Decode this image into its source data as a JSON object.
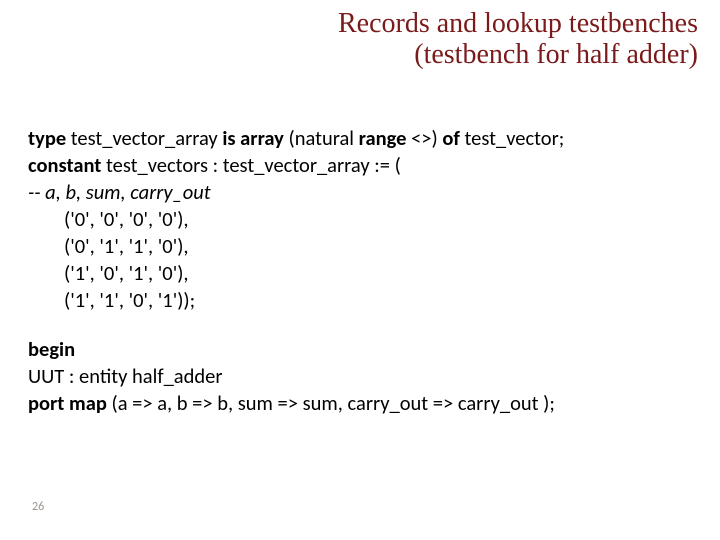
{
  "title_line1": "Records and lookup testbenches",
  "title_line2": "(testbench for half adder)",
  "code": {
    "l1_pre": "type ",
    "l1_mid": "test_vector_array ",
    "l1_key2": "is array ",
    "l1_paren": "(natural ",
    "l1_key3": "range ",
    "l1_tail": "<>) ",
    "l1_key4": "of ",
    "l1_end": "test_vector;",
    "l2_key": "constant ",
    "l2_rest": "test_vectors : test_vector_array := (",
    "l3": "-- a, b, sum, carry_out",
    "l4": "('0', '0', '0', '0'),",
    "l5": "('0', '1', '1', '0'),",
    "l6": "('1', '0', '1', '0'),",
    "l7": "('1', '1', '0', '1'));",
    "b1": "begin",
    "b2": "UUT : entity half_adder",
    "b3_key": "port map ",
    "b3_rest": "(a => a, b => b, sum => sum, carry_out => carry_out );"
  },
  "page_number": "26"
}
